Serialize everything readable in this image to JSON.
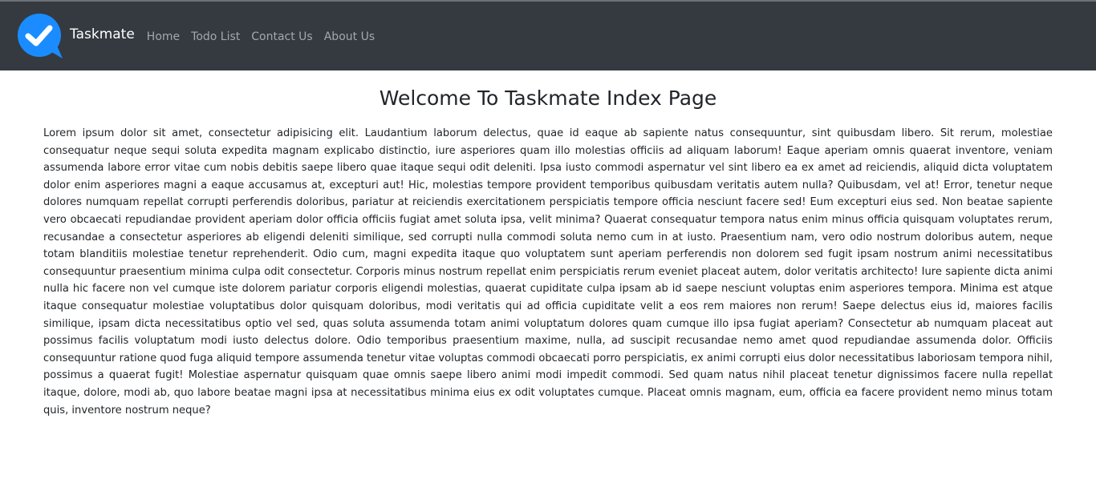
{
  "navbar": {
    "brand": "Taskmate",
    "links": [
      "Home",
      "Todo List",
      "Contact Us",
      "About Us"
    ],
    "logo_icon": "check-bubble-icon",
    "background": "#343a40",
    "logo_color": "#1a8cff"
  },
  "main": {
    "title": "Welcome To Taskmate Index Page",
    "body": "Lorem ipsum dolor sit amet, consectetur adipisicing elit. Laudantium laborum delectus, quae id eaque ab sapiente natus consequuntur, sint quibusdam libero. Sit rerum, molestiae consequatur neque sequi soluta expedita magnam explicabo distinctio, iure asperiores quam illo molestias officiis ad aliquam laborum! Eaque aperiam omnis quaerat inventore, veniam assumenda labore error vitae cum nobis debitis saepe libero quae itaque sequi odit deleniti. Ipsa iusto commodi aspernatur vel sint libero ea ex amet ad reiciendis, aliquid dicta voluptatem dolor enim asperiores magni a eaque accusamus at, excepturi aut! Hic, molestias tempore provident temporibus quibusdam veritatis autem nulla? Quibusdam, vel at! Error, tenetur neque dolores numquam repellat corrupti perferendis doloribus, pariatur at reiciendis exercitationem perspiciatis tempore officia nesciunt facere sed! Eum excepturi eius sed. Non beatae sapiente vero obcaecati repudiandae provident aperiam dolor officia officiis fugiat amet soluta ipsa, velit minima? Quaerat consequatur tempora natus enim minus officia quisquam voluptates rerum, recusandae a consectetur asperiores ab eligendi deleniti similique, sed corrupti nulla commodi soluta nemo cum in at iusto. Praesentium nam, vero odio nostrum doloribus autem, neque totam blanditiis molestiae tenetur reprehenderit. Odio cum, magni expedita itaque quo voluptatem sunt aperiam perferendis non dolorem sed fugit ipsam nostrum animi necessitatibus consequuntur praesentium minima culpa odit consectetur. Corporis minus nostrum repellat enim perspiciatis rerum eveniet placeat autem, dolor veritatis architecto! Iure sapiente dicta animi nulla hic facere non vel cumque iste dolorem pariatur corporis eligendi molestias, quaerat cupiditate culpa ipsam ab id saepe nesciunt voluptas enim asperiores tempora. Minima est atque itaque consequatur molestiae voluptatibus dolor quisquam doloribus, modi veritatis qui ad officia cupiditate velit a eos rem maiores non rerum! Saepe delectus eius id, maiores facilis similique, ipsam dicta necessitatibus optio vel sed, quas soluta assumenda totam animi voluptatum dolores quam cumque illo ipsa fugiat aperiam? Consectetur ab numquam placeat aut possimus facilis voluptatum modi iusto delectus dolore. Odio temporibus praesentium maxime, nulla, ad suscipit recusandae nemo amet quod repudiandae assumenda dolor. Officiis consequuntur ratione quod fuga aliquid tempore assumenda tenetur vitae voluptas commodi obcaecati porro perspiciatis, ex animi corrupti eius dolor necessitatibus laboriosam tempora nihil, possimus a quaerat fugit! Molestiae aspernatur quisquam quae omnis saepe libero animi modi impedit commodi. Sed quam natus nihil placeat tenetur dignissimos facere nulla repellat itaque, dolore, modi ab, quo labore beatae magni ipsa at necessitatibus minima eius ex odit voluptates cumque. Placeat omnis magnam, eum, officia ea facere provident nemo minus totam quis, inventore nostrum neque?"
  }
}
